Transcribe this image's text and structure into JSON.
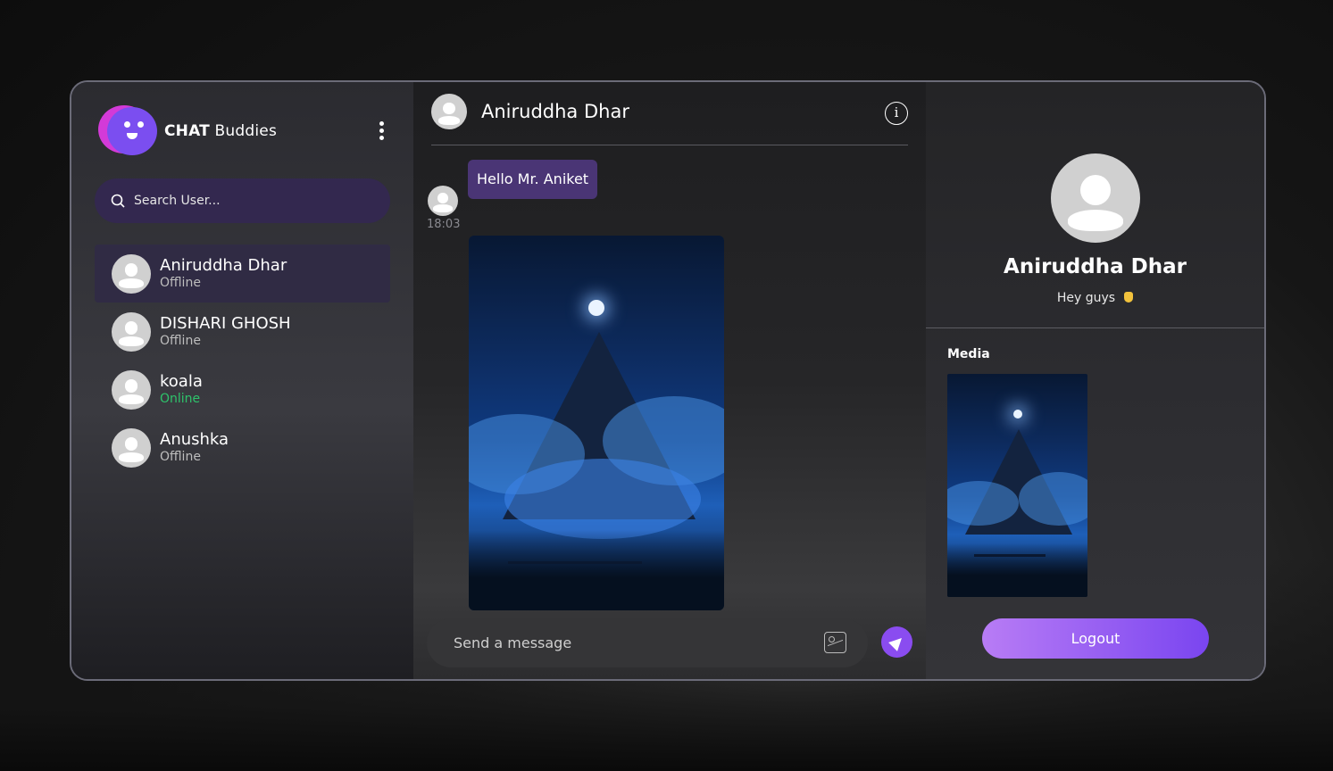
{
  "brand": {
    "bold": "CHAT",
    "rest": "Buddies"
  },
  "search": {
    "placeholder": "Search User..."
  },
  "contacts": [
    {
      "name": "Aniruddha Dhar",
      "status": "Offline"
    },
    {
      "name": "DISHARI GHOSH",
      "status": "Offline"
    },
    {
      "name": "koala",
      "status": "Online"
    },
    {
      "name": "Anushka",
      "status": "Offline"
    }
  ],
  "chat": {
    "title": "Aniruddha Dhar",
    "messages": [
      {
        "text": "Hello Mr. Aniket",
        "time": "18:03"
      }
    ]
  },
  "composer": {
    "placeholder": "Send a message"
  },
  "profile": {
    "name": "Aniruddha Dhar",
    "bio": "Hey guys"
  },
  "media": {
    "label": "Media"
  },
  "logout": {
    "label": "Logout"
  },
  "colors": {
    "accent": "#8a4cf0",
    "online": "#2ec36b",
    "bubble": "#4a3575",
    "search_bg": "#33284f"
  },
  "icons": [
    "kebab-menu-icon",
    "search-icon",
    "user-avatar-icon",
    "info-icon",
    "image-upload-icon",
    "send-icon",
    "waving-hand-icon"
  ]
}
